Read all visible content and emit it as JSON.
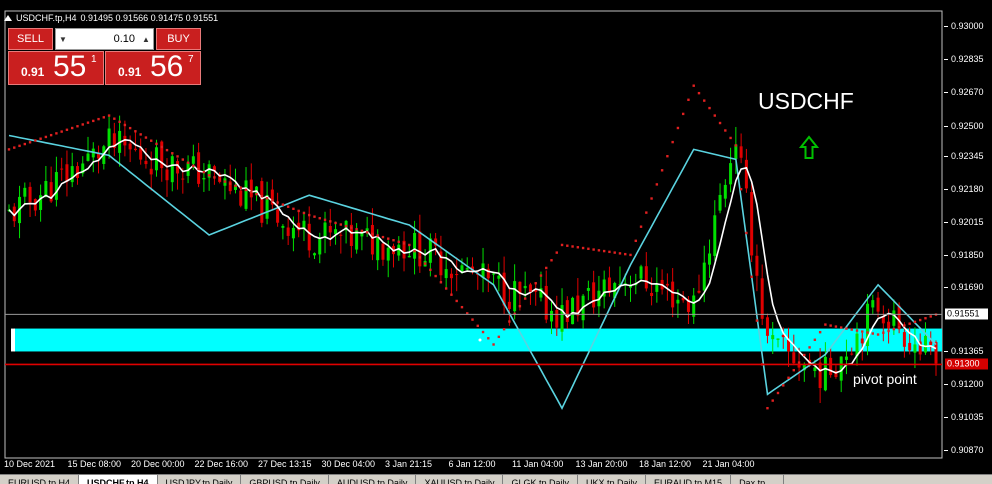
{
  "header": {
    "symbol_tf": "USDCHF.tp,H4",
    "ohlc": "0.91495 0.91566 0.91475 0.91551"
  },
  "trade_panel": {
    "sell_label": "SELL",
    "buy_label": "BUY",
    "lot_value": "0.10",
    "sell_quote": {
      "small": "0.91",
      "big": "55",
      "sup": "1"
    },
    "buy_quote": {
      "small": "0.91",
      "big": "56",
      "sup": "7"
    }
  },
  "overlay": {
    "symbol_text": "USDCHF",
    "pivot_text": "pivot point"
  },
  "price_axis": {
    "labels": [
      "0.93000",
      "0.92835",
      "0.92670",
      "0.92500",
      "0.92345",
      "0.92180",
      "0.92015",
      "0.91850",
      "0.91690",
      "0.91365",
      "0.91200",
      "0.91035",
      "0.90870"
    ],
    "current_price": "0.91551",
    "pivot_price": "0.91300"
  },
  "time_axis": {
    "labels": [
      "10 Dec 2021",
      "15 Dec 08:00",
      "20 Dec 00:00",
      "22 Dec 16:00",
      "27 Dec 13:15",
      "30 Dec 04:00",
      "3 Jan 21:15",
      "6 Jan 12:00",
      "11 Jan 04:00",
      "13 Jan 20:00",
      "18 Jan 12:00",
      "21 Jan 04:00"
    ]
  },
  "tabs": [
    "EURUSD.tp,H4",
    "USDCHF.tp,H4",
    "USDJPY.tp,Daily",
    "GBPUSD.tp,Daily",
    "AUDUSD.tp,Daily",
    "XAUUSD.tp,Daily",
    "GLGK.tp,Daily",
    "UKX.tp,Daily",
    "EURAUD.tp,M15",
    "Dax.tp,..."
  ],
  "colors": {
    "bull": "#00e000",
    "bear": "#e00000",
    "ma_fast": "#ffffff",
    "ma_slow": "#5ad3e0",
    "sar": "#e02020",
    "zone": "#00ffff",
    "pivot_line": "#e00000",
    "arrow": "#00c000"
  },
  "chart_data": {
    "type": "candlestick",
    "ylim": [
      0.9087,
      0.9303
    ],
    "current_price": 0.91551,
    "pivot": 0.913,
    "support_zone": [
      0.91365,
      0.9148
    ],
    "segments": [
      [
        0,
        0.9205,
        0.9245,
        0.9238,
        0.9235
      ],
      [
        19,
        0.924,
        0.9235,
        0.9255,
        0.9225
      ],
      [
        38,
        0.9225,
        0.9195,
        0.9225,
        0.9195
      ],
      [
        57,
        0.9195,
        0.9215,
        0.9205,
        0.9185
      ],
      [
        76,
        0.919,
        0.92,
        0.919,
        0.917
      ],
      [
        92,
        0.917,
        0.917,
        0.914,
        0.916
      ],
      [
        105,
        0.9155,
        0.9108,
        0.919,
        0.9175
      ],
      [
        118,
        0.9175,
        0.918,
        0.9185,
        0.9162
      ],
      [
        130,
        0.916,
        0.9238,
        0.927,
        0.9245
      ],
      [
        138,
        0.9245,
        0.9233,
        0.924,
        0.914
      ],
      [
        144,
        0.914,
        0.9115,
        0.9108,
        0.9108
      ],
      [
        155,
        0.9125,
        0.9135,
        0.915,
        0.916
      ],
      [
        165,
        0.916,
        0.917,
        0.9145,
        0.913
      ],
      [
        176,
        0.913,
        0.914,
        0.9155,
        0.9155
      ]
    ]
  }
}
